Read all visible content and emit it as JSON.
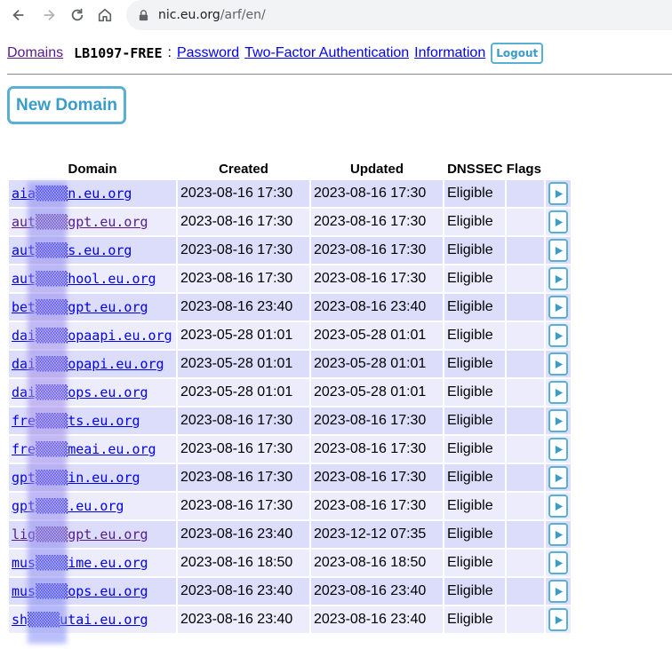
{
  "browser": {
    "url_host": "nic.eu.org",
    "url_path": "/arf/en/"
  },
  "nav": {
    "domains_link": "Domains",
    "account_handle": "LB1097-FREE",
    "separator": ":",
    "password_link": "Password",
    "two_factor_link": "Two-Factor Authentication",
    "information_link": "Information",
    "logout_button": "Logout"
  },
  "new_domain_button": "New Domain",
  "table": {
    "headers": [
      "Domain",
      "Created",
      "Updated",
      "DNSSEC Flags"
    ],
    "rows": [
      {
        "domain": "aia▒▒▒▒n.eu.org",
        "created": "2023-08-16 17:30",
        "updated": "2023-08-16 17:30",
        "dnssec": "Eligible",
        "visited": false
      },
      {
        "domain": "aut▒▒▒▒gpt.eu.org",
        "created": "2023-08-16 17:30",
        "updated": "2023-08-16 17:30",
        "dnssec": "Eligible",
        "visited": true
      },
      {
        "domain": "aut▒▒▒▒s.eu.org",
        "created": "2023-08-16 17:30",
        "updated": "2023-08-16 17:30",
        "dnssec": "Eligible",
        "visited": false
      },
      {
        "domain": "aut▒▒▒▒hool.eu.org",
        "created": "2023-08-16 17:30",
        "updated": "2023-08-16 17:30",
        "dnssec": "Eligible",
        "visited": false
      },
      {
        "domain": "bet▒▒▒▒gpt.eu.org",
        "created": "2023-08-16 23:40",
        "updated": "2023-08-16 23:40",
        "dnssec": "Eligible",
        "visited": false
      },
      {
        "domain": "dai▒▒▒▒opaapi.eu.org",
        "created": "2023-05-28 01:01",
        "updated": "2023-05-28 01:01",
        "dnssec": "Eligible",
        "visited": false
      },
      {
        "domain": "dai▒▒▒▒opapi.eu.org",
        "created": "2023-05-28 01:01",
        "updated": "2023-05-28 01:01",
        "dnssec": "Eligible",
        "visited": false
      },
      {
        "domain": "dai▒▒▒▒ops.eu.org",
        "created": "2023-05-28 01:01",
        "updated": "2023-05-28 01:01",
        "dnssec": "Eligible",
        "visited": false
      },
      {
        "domain": "fre▒▒▒▒ts.eu.org",
        "created": "2023-08-16 17:30",
        "updated": "2023-08-16 17:30",
        "dnssec": "Eligible",
        "visited": false
      },
      {
        "domain": "fre▒▒▒▒meai.eu.org",
        "created": "2023-08-16 17:30",
        "updated": "2023-08-16 17:30",
        "dnssec": "Eligible",
        "visited": false
      },
      {
        "domain": "gpt▒▒▒▒in.eu.org",
        "created": "2023-08-16 17:30",
        "updated": "2023-08-16 17:30",
        "dnssec": "Eligible",
        "visited": false
      },
      {
        "domain": "gpt▒▒▒▒.eu.org",
        "created": "2023-08-16 17:30",
        "updated": "2023-08-16 17:30",
        "dnssec": "Eligible",
        "visited": false
      },
      {
        "domain": "lig▒▒▒▒gpt.eu.org",
        "created": "2023-08-16 23:40",
        "updated": "2023-12-12 07:35",
        "dnssec": "Eligible",
        "visited": true
      },
      {
        "domain": "mus▒▒▒▒ime.eu.org",
        "created": "2023-08-16 18:50",
        "updated": "2023-08-16 18:50",
        "dnssec": "Eligible",
        "visited": false
      },
      {
        "domain": "mus▒▒▒▒ops.eu.org",
        "created": "2023-08-16 23:40",
        "updated": "2023-08-16 23:40",
        "dnssec": "Eligible",
        "visited": false
      },
      {
        "domain": "sh▒▒▒▒utai.eu.org",
        "created": "2023-08-16 23:40",
        "updated": "2023-08-16 23:40",
        "dnssec": "Eligible",
        "visited": false
      }
    ]
  },
  "icons": {
    "back": "back-arrow-icon",
    "forward": "forward-arrow-icon",
    "reload": "reload-icon",
    "home": "home-icon",
    "site_info": "site-info-icon",
    "row_action": "play-icon"
  },
  "colors": {
    "link": "#0000ee",
    "visited_link": "#551a8b",
    "button_border": "#5ab0d0",
    "row_odd": "#dcdcfb",
    "row_even": "#ececfd"
  }
}
